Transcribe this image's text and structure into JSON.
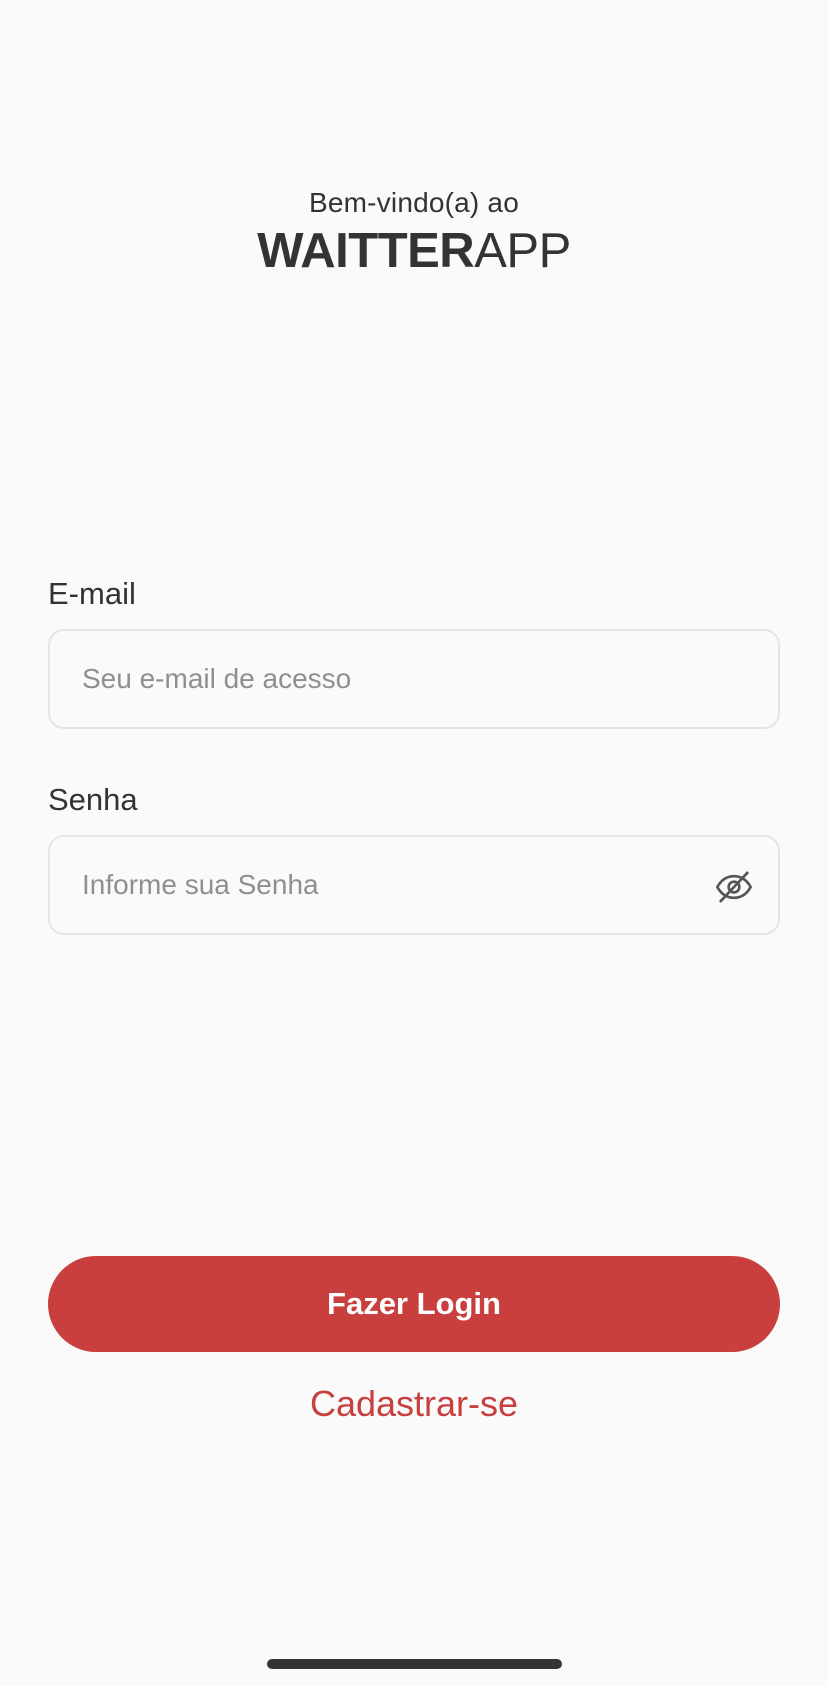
{
  "header": {
    "welcome": "Bem-vindo(a) ao",
    "brand_bold": "WAITTER",
    "brand_light": "APP"
  },
  "form": {
    "email": {
      "label": "E-mail",
      "placeholder": "Seu e-mail de acesso",
      "value": ""
    },
    "password": {
      "label": "Senha",
      "placeholder": "Informe sua Senha",
      "value": "",
      "toggle_icon": "eye-off-icon"
    }
  },
  "actions": {
    "login_label": "Fazer Login",
    "signup_label": "Cadastrar-se"
  },
  "colors": {
    "brand_red": "#c83f3e",
    "text": "#333333",
    "placeholder": "#8f8f8f",
    "border": "#e5e5e5",
    "background": "#fafafa"
  }
}
